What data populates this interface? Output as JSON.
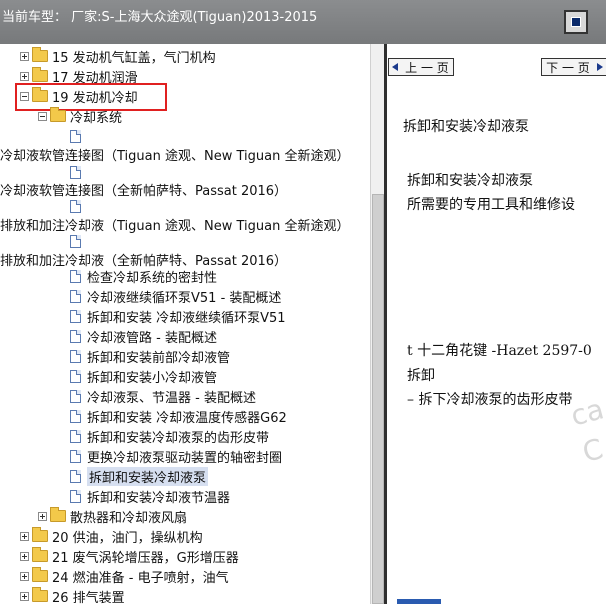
{
  "title": "当前车型： 厂家:S-上海大众途观(Tiguan)2013-2015",
  "tree": {
    "items": [
      {
        "label": "15 发动机气缸盖，气门机构"
      },
      {
        "label": "17 发动机润滑"
      },
      {
        "label": "19 发动机冷却"
      },
      {
        "label": "冷却系统"
      },
      {
        "label": ""
      },
      {
        "label": "冷却液软管连接图（Tiguan 途观、New Tiguan 全新途观）"
      },
      {
        "label": ""
      },
      {
        "label": "冷却液软管连接图（全新帕萨特、Passat 2016）"
      },
      {
        "label": ""
      },
      {
        "label": "排放和加注冷却液（Tiguan 途观、New Tiguan 全新途观）"
      },
      {
        "label": ""
      },
      {
        "label": "排放和加注冷却液（全新帕萨特、Passat 2016）"
      },
      {
        "label": "检查冷却系统的密封性"
      },
      {
        "label": "冷却液继续循环泵V51 - 装配概述"
      },
      {
        "label": "拆卸和安装 冷却液继续循环泵V51"
      },
      {
        "label": "冷却液管路 - 装配概述"
      },
      {
        "label": "拆卸和安装前部冷却液管"
      },
      {
        "label": "拆卸和安装小冷却液管"
      },
      {
        "label": "冷却液泵、节温器 - 装配概述"
      },
      {
        "label": "拆卸和安装 冷却液温度传感器G62"
      },
      {
        "label": "拆卸和安装冷却液泵的齿形皮带"
      },
      {
        "label": "更换冷却液泵驱动装置的轴密封圈"
      },
      {
        "label": "拆卸和安装冷却液泵"
      },
      {
        "label": "拆卸和安装冷却液节温器"
      },
      {
        "label": "散热器和冷却液风扇"
      },
      {
        "label": "20 供油，油门，操纵机构"
      },
      {
        "label": "21 废气涡轮增压器，G形增压器"
      },
      {
        "label": "24 燃油准备 - 电子喷射，油气"
      },
      {
        "label": "26 排气装置"
      }
    ]
  },
  "content": {
    "prev_label": "上 一 页",
    "next_label": "下 一 页",
    "heading": "拆卸和安装冷却液泵",
    "subheading": "拆卸和安装冷却液泵",
    "tools_line": "所需要的专用工具和维修设",
    "tool_item": "t  十二角花键  -Hazet 2597-0",
    "remove_label": "拆卸",
    "step1": "–  拆下冷却液泵的齿形皮带"
  },
  "colors": {
    "titlebar": "#808284",
    "highlight_box": "#e02020",
    "selection": "#d6dff0"
  }
}
